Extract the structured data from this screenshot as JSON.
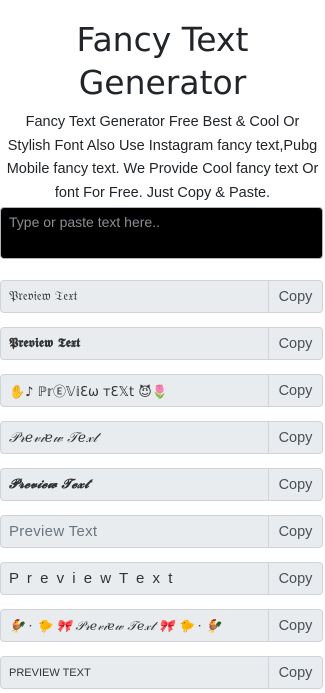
{
  "header": {
    "title": "Fancy Text Generator",
    "description": "Fancy Text Generator Free Best & Cool Or Stylish Font Also Use Instagram fancy text,Pubg Mobile fancy text. We Provide Cool fancy text Or font For Free. Just Copy & Paste."
  },
  "input": {
    "placeholder": "Type or paste text here.."
  },
  "results": [
    {
      "preview": "𝔓𝔯𝔢𝔳𝔦𝔢𝔴 𝔗𝔢𝔵𝔱",
      "copy_label": "Copy"
    },
    {
      "preview": "𝕻𝖗𝖊𝖛𝖎𝖊𝖜 𝕿𝖊𝖝𝖙",
      "copy_label": "Copy"
    },
    {
      "preview": "✋♪  ℙ𝕣Ⓔ𝕍𝕚Ɛω тƐ𝕏t  😈🌷",
      "copy_label": "Copy"
    },
    {
      "preview": "𝒫𝓇𝑒𝓋𝒾𝑒𝓌 𝒯𝑒𝓍𝓉",
      "copy_label": "Copy"
    },
    {
      "preview": "𝓟𝓻𝓮𝓿𝓲𝓮𝔀 𝓣𝓮𝔁𝓽",
      "copy_label": "Copy"
    },
    {
      "preview": "Preview Text",
      "copy_label": "Copy"
    },
    {
      "preview": "P r e v i e w T e x t",
      "copy_label": "Copy"
    },
    {
      "preview": "🐓 · 🐤  🎀  𝒫𝓇𝑒𝓋𝒾𝑒𝓌 𝒯𝑒𝓍𝓉  🎀  🐤 · 🐓",
      "copy_label": "Copy"
    },
    {
      "preview": "PREVIEW TEXT",
      "copy_label": "Copy"
    }
  ]
}
